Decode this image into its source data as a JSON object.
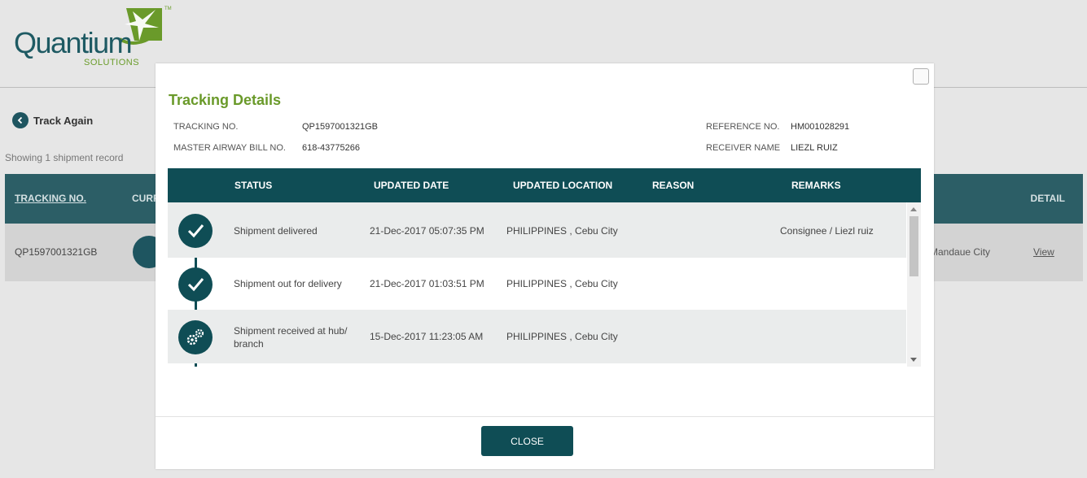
{
  "brand": {
    "name": "Quantium",
    "sub": "SOLUTIONS",
    "tm": "TM"
  },
  "page": {
    "track_again": "Track Again",
    "showing": "Showing 1 shipment record",
    "table": {
      "headers": [
        "TRACKING NO.",
        "CURR",
        "DETAIL"
      ],
      "row": {
        "tracking_no": "QP1597001321GB",
        "location_partial": "Mandaue City",
        "detail_link": "View"
      }
    }
  },
  "modal": {
    "title": "Tracking Details",
    "tracking_no_label": "TRACKING NO.",
    "tracking_no": "QP1597001321GB",
    "mawb_label": "MASTER AIRWAY BILL NO.",
    "mawb": "618-43775266",
    "reference_label": "REFERENCE NO.",
    "reference": "HM001028291",
    "receiver_label": "RECEIVER NAME",
    "receiver": "LIEZL RUIZ",
    "columns": {
      "status": "STATUS",
      "updated_date": "UPDATED DATE",
      "updated_location": "UPDATED LOCATION",
      "reason": "REASON",
      "remarks": "REMARKS"
    },
    "rows": [
      {
        "icon": "check-icon",
        "status": "Shipment delivered",
        "date": "21-Dec-2017 05:07:35 PM",
        "location": "PHILIPPINES , Cebu City",
        "reason": "",
        "remarks": "Consignee / Liezl ruiz"
      },
      {
        "icon": "check-icon",
        "status": "Shipment out for delivery",
        "date": "21-Dec-2017 01:03:51 PM",
        "location": "PHILIPPINES , Cebu City",
        "reason": "",
        "remarks": ""
      },
      {
        "icon": "gears-icon",
        "status": "Shipment received at hub/ branch",
        "date": "15-Dec-2017 11:23:05 AM",
        "location": "PHILIPPINES , Cebu City",
        "reason": "",
        "remarks": ""
      }
    ],
    "close_label": "CLOSE"
  },
  "colors": {
    "primary": "#0f4d55",
    "brand_green": "#6a9a2a",
    "overlay_bg": "#e6e6e6"
  }
}
